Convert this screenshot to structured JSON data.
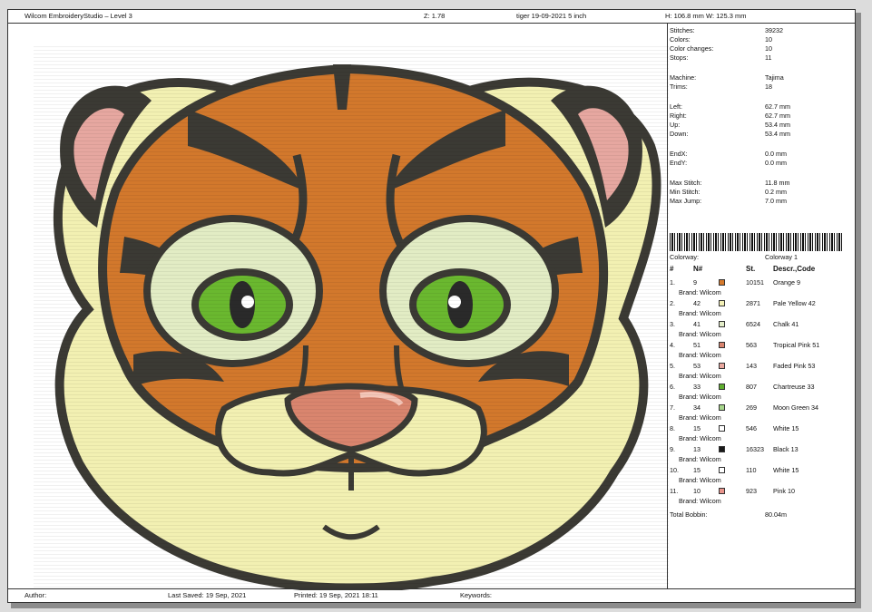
{
  "header": {
    "app_title": "Wilcom EmbroideryStudio – Level 3",
    "zoom": "Z: 1.78",
    "design_name": "tiger 19-09-2021 5 inch",
    "dimensions": "H: 106.8 mm   W: 125.3 mm"
  },
  "stats": {
    "stitches": {
      "label": "Stitches:",
      "value": "39232"
    },
    "colors": {
      "label": "Colors:",
      "value": "10"
    },
    "color_changes": {
      "label": "Color changes:",
      "value": "10"
    },
    "stops": {
      "label": "Stops:",
      "value": "11"
    },
    "machine": {
      "label": "Machine:",
      "value": "Tajima"
    },
    "trims": {
      "label": "Trims:",
      "value": "18"
    },
    "left": {
      "label": "Left:",
      "value": "62.7 mm"
    },
    "right": {
      "label": "Right:",
      "value": "62.7 mm"
    },
    "up": {
      "label": "Up:",
      "value": "53.4 mm"
    },
    "down": {
      "label": "Down:",
      "value": "53.4 mm"
    },
    "endx": {
      "label": "EndX:",
      "value": "0.0 mm"
    },
    "endy": {
      "label": "EndY:",
      "value": "0.0 mm"
    },
    "max_stitch": {
      "label": "Max Stitch:",
      "value": "11.8 mm"
    },
    "min_stitch": {
      "label": "Min Stitch:",
      "value": "0.2 mm"
    },
    "max_jump": {
      "label": "Max Jump:",
      "value": "7.0 mm"
    }
  },
  "colorway": {
    "label": "Colorway:",
    "value": "Colorway 1"
  },
  "table_headers": {
    "num": "#",
    "n": "N#",
    "st": "St.",
    "desc": "Descr.,Code"
  },
  "brand_label": "Brand: Wilcom",
  "colors_table": [
    {
      "num": "1.",
      "n": "9",
      "st": "10151",
      "desc": "Orange 9",
      "color": "#d67a2c"
    },
    {
      "num": "2.",
      "n": "42",
      "st": "2871",
      "desc": "Pale Yellow 42",
      "color": "#f3f0b6"
    },
    {
      "num": "3.",
      "n": "41",
      "st": "6524",
      "desc": "Chalk 41",
      "color": "#e3edc8"
    },
    {
      "num": "4.",
      "n": "51",
      "st": "563",
      "desc": "Tropical Pink 51",
      "color": "#d8846e"
    },
    {
      "num": "5.",
      "n": "53",
      "st": "143",
      "desc": "Faded Pink 53",
      "color": "#e9a79e"
    },
    {
      "num": "6.",
      "n": "33",
      "st": "807",
      "desc": "Chartreuse 33",
      "color": "#5fae2e"
    },
    {
      "num": "7.",
      "n": "34",
      "st": "269",
      "desc": "Moon Green 34",
      "color": "#a7d68b"
    },
    {
      "num": "8.",
      "n": "15",
      "st": "546",
      "desc": "White 15",
      "color": "#ffffff"
    },
    {
      "num": "9.",
      "n": "13",
      "st": "16323",
      "desc": "Black 13",
      "color": "#1a1a1a"
    },
    {
      "num": "10.",
      "n": "15",
      "st": "110",
      "desc": "White 15",
      "color": "#ffffff"
    },
    {
      "num": "11.",
      "n": "10",
      "st": "923",
      "desc": "Pink 10",
      "color": "#e8948c"
    }
  ],
  "total_bobbin": {
    "label": "Total Bobbin:",
    "value": "80.04m"
  },
  "footer": {
    "author": "Author:",
    "last_saved": "Last Saved: 19 Sep, 2021",
    "printed": "Printed: 19 Sep, 2021 18:11",
    "keywords": "Keywords:"
  },
  "palette": {
    "orange": "#d2782c",
    "cream": "#f2f0b2",
    "eye_white": "#e2ecc4",
    "outline": "#3b3a34",
    "ear_pink": "#e6a7a0",
    "nose": "#d9856e",
    "eye_green": "#6ab82f",
    "pupil": "#2a2a2a"
  }
}
